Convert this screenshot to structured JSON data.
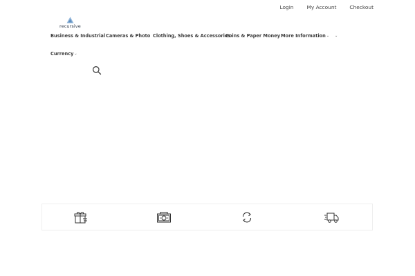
{
  "header": {
    "links": [
      {
        "label": "Login"
      },
      {
        "label": "My Account"
      },
      {
        "label": "Checkout"
      }
    ],
    "logo_text": "recursive"
  },
  "nav": {
    "items": [
      {
        "label": "Business & Industrial"
      },
      {
        "label": "Cameras & Photo"
      },
      {
        "label": "Clothing, Shoes & Accessories"
      },
      {
        "label": "Coins & Paper Money"
      },
      {
        "label": "More Information"
      },
      {
        "label": "Currency"
      }
    ]
  },
  "features": [
    {
      "icon": "gift-card-icon"
    },
    {
      "icon": "money-icon"
    },
    {
      "icon": "refresh-icon"
    },
    {
      "icon": "delivery-truck-icon"
    }
  ],
  "colors": {
    "text": "#333333",
    "logo": "#2f3a4a",
    "logo_accent": "#8fb4d9",
    "border": "#eeeeee"
  }
}
